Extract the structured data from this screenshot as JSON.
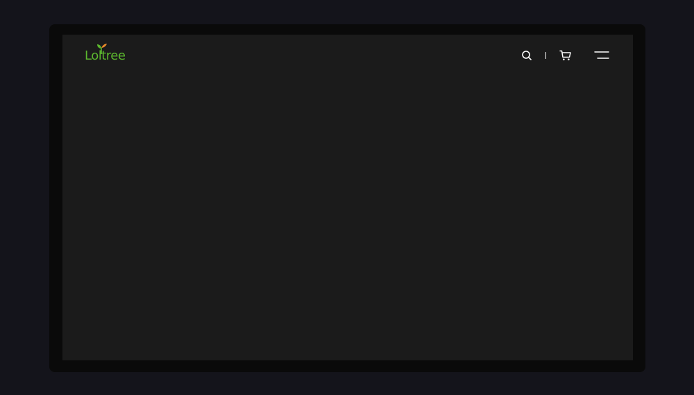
{
  "brand": {
    "name": "Loltree",
    "colors": {
      "logo_green": "#5cb82e",
      "leaf_orange": "#e8892a",
      "background": "#1b1b1b",
      "icon": "#ffffff"
    }
  },
  "header": {
    "icons": [
      "search-icon",
      "cart-icon",
      "hamburger-menu-icon"
    ]
  }
}
